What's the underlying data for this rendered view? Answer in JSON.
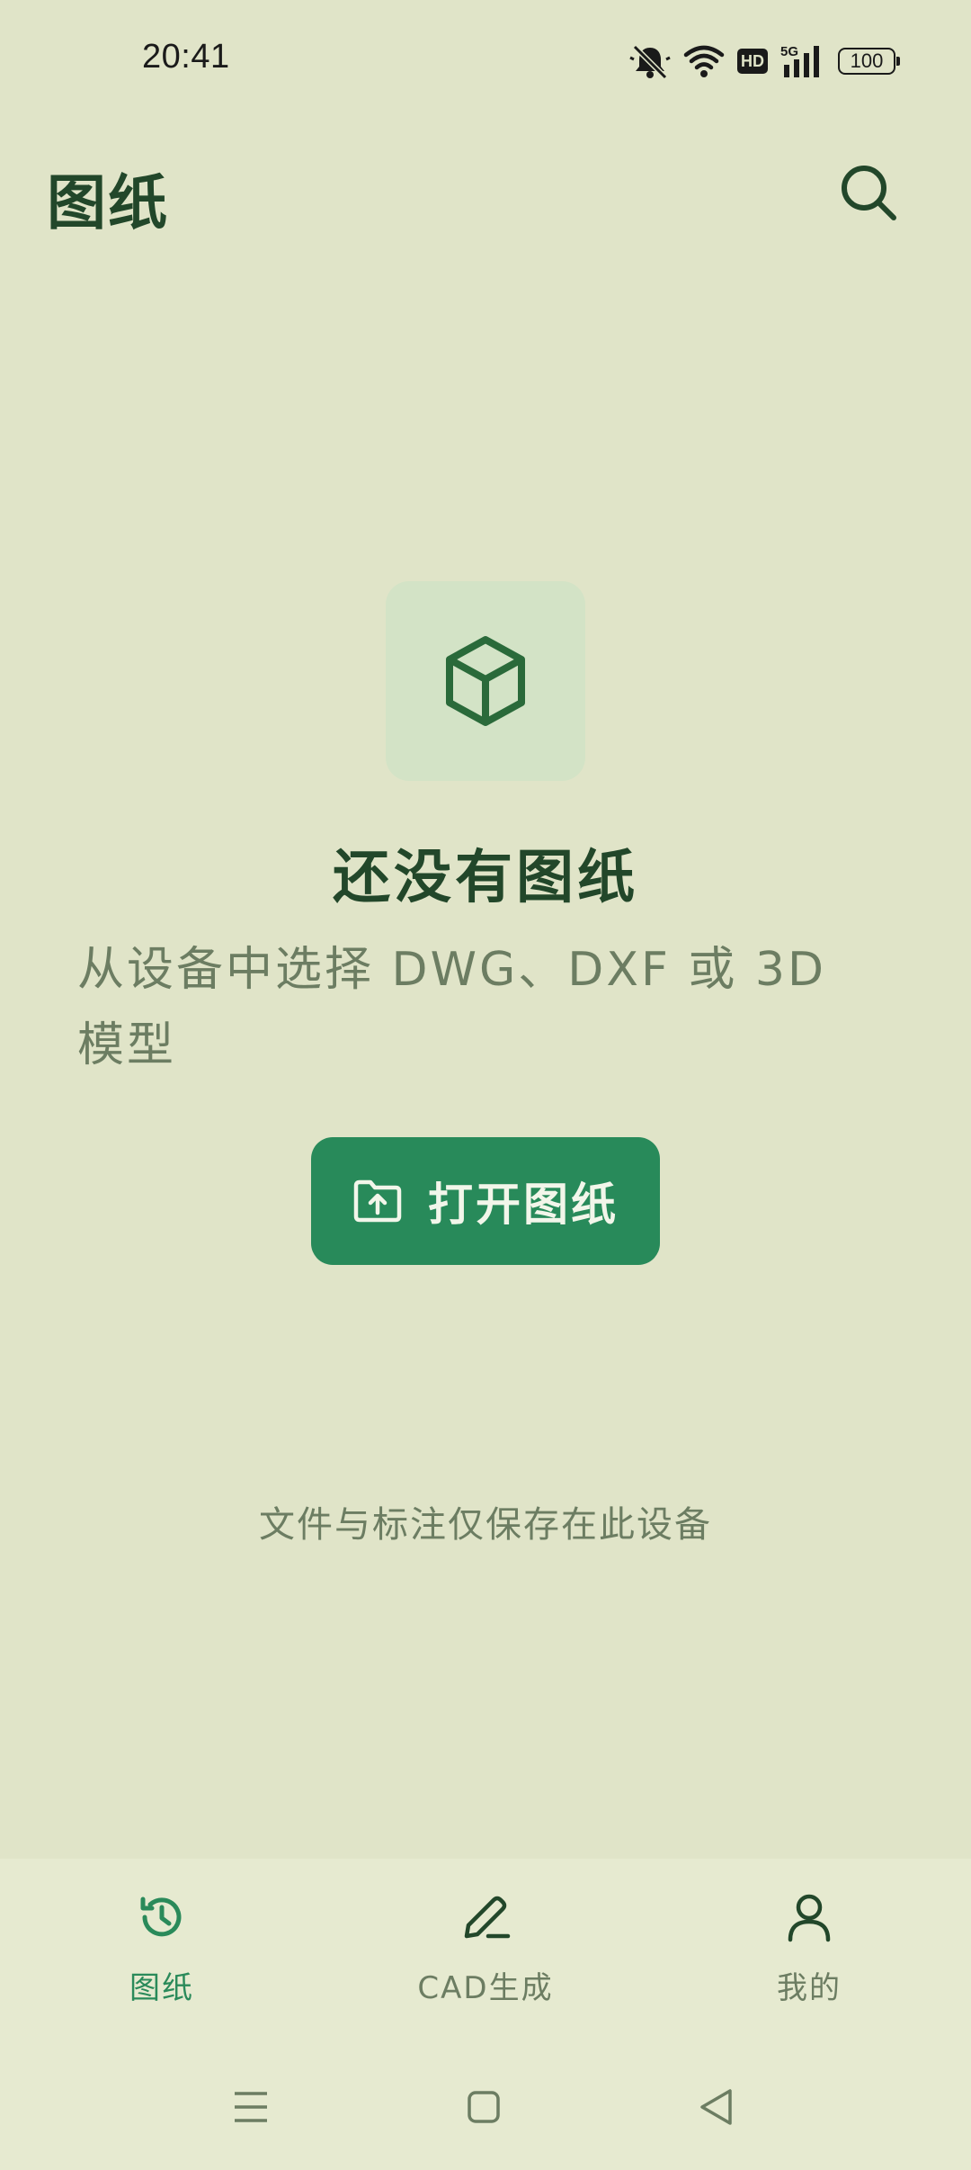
{
  "status_bar": {
    "time": "20:41",
    "network": "5G",
    "hd_label": "HD",
    "battery": "100",
    "icons": [
      "bell-muted-icon",
      "wifi-icon",
      "hd-icon",
      "signal-5g-icon",
      "battery-icon"
    ]
  },
  "header": {
    "title": "图纸",
    "search_icon": "search-icon"
  },
  "empty_state": {
    "icon": "cube-icon",
    "title": "还没有图纸",
    "subtitle": "从设备中选择 DWG、DXF 或 3D 模型",
    "button_icon": "folder-upload-icon",
    "button_label": "打开图纸",
    "footnote": "文件与标注仅保存在此设备"
  },
  "bottom_nav": {
    "items": [
      {
        "label": "图纸",
        "icon": "history-icon",
        "active": true
      },
      {
        "label": "CAD生成",
        "icon": "pencil-icon",
        "active": false
      },
      {
        "label": "我的",
        "icon": "user-icon",
        "active": false
      }
    ]
  },
  "system_nav": {
    "icons": [
      "menu-icon",
      "home-icon",
      "back-icon"
    ]
  },
  "colors": {
    "background": "#e0e4c8",
    "primary": "#288a5a",
    "title_text": "#22472a",
    "muted_text": "#6c7d62",
    "tile": "#d3e3c6"
  }
}
